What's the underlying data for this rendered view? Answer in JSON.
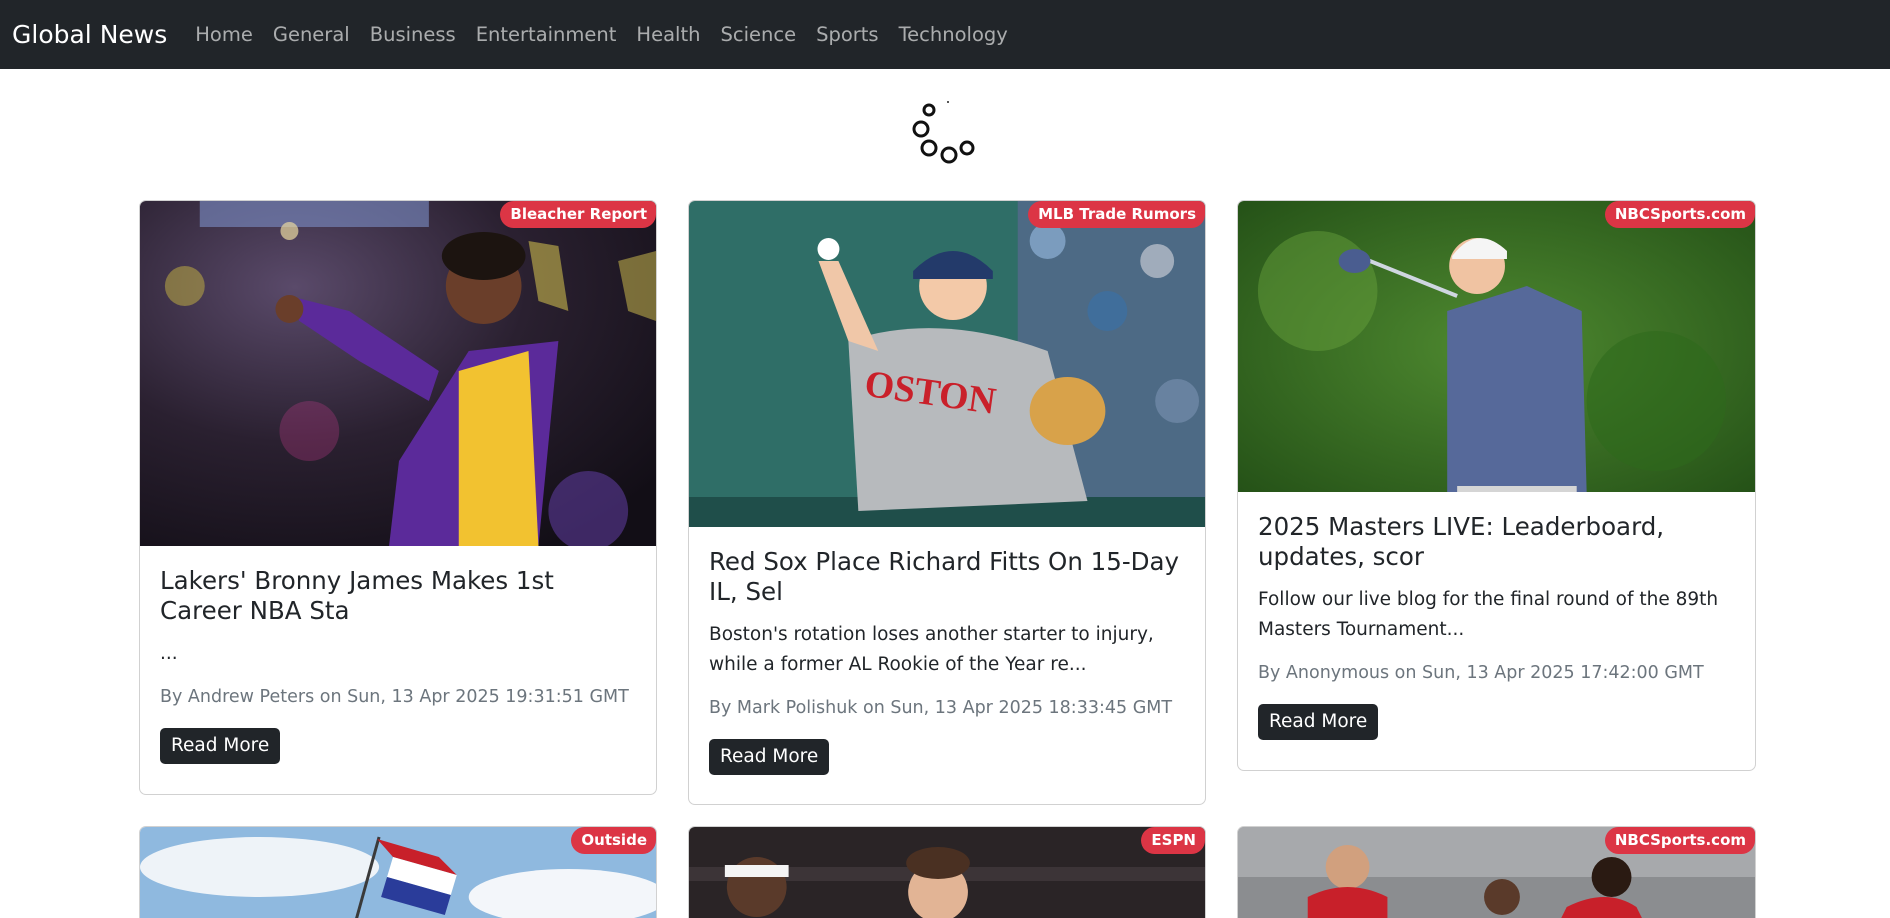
{
  "navbar": {
    "brand": "Global News",
    "links": [
      "Home",
      "General",
      "Business",
      "Entertainment",
      "Health",
      "Science",
      "Sports",
      "Technology"
    ]
  },
  "articles": [
    {
      "source": "Bleacher Report",
      "title": "Lakers' Bronny James Makes 1st Career NBA Sta",
      "description": "...",
      "meta": "By Andrew Peters on Sun, 13 Apr 2025 19:31:51 GMT",
      "button": "Read More"
    },
    {
      "source": "MLB Trade Rumors",
      "title": "Red Sox Place Richard Fitts On 15-Day IL, Sel",
      "description": "Boston's rotation loses another starter to injury, while a former AL Rookie of the Year re...",
      "meta": "By Mark Polishuk on Sun, 13 Apr 2025 18:33:45 GMT",
      "button": "Read More"
    },
    {
      "source": "NBCSports.com",
      "title": "2025 Masters LIVE: Leaderboard, updates, scor",
      "description": "Follow our live blog for the final round of the 89th Masters Tournament...",
      "meta": "By Anonymous on Sun, 13 Apr 2025 17:42:00 GMT",
      "button": "Read More"
    },
    {
      "source": "Outside"
    },
    {
      "source": "ESPN"
    },
    {
      "source": "NBCSports.com"
    }
  ],
  "colors": {
    "navbar_bg": "#212529",
    "badge_bg": "#dc3545",
    "button_bg": "#212529"
  }
}
